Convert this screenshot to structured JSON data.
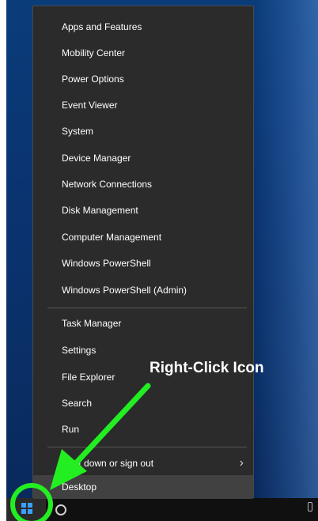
{
  "menu": {
    "groups": [
      {
        "items": [
          {
            "label": "Apps and Features"
          },
          {
            "label": "Mobility Center"
          },
          {
            "label": "Power Options"
          },
          {
            "label": "Event Viewer"
          },
          {
            "label": "System"
          },
          {
            "label": "Device Manager"
          },
          {
            "label": "Network Connections"
          },
          {
            "label": "Disk Management"
          },
          {
            "label": "Computer Management"
          },
          {
            "label": "Windows PowerShell"
          },
          {
            "label": "Windows PowerShell (Admin)"
          }
        ]
      },
      {
        "items": [
          {
            "label": "Task Manager"
          },
          {
            "label": "Settings"
          },
          {
            "label": "File Explorer"
          },
          {
            "label": "Search"
          },
          {
            "label": "Run"
          }
        ]
      },
      {
        "items": [
          {
            "label": "Shut down or sign out",
            "submenu": true
          },
          {
            "label": "Desktop",
            "active": true
          }
        ]
      }
    ]
  },
  "annotation": {
    "text": "Right-Click Icon",
    "color": "#22ee22"
  },
  "colors": {
    "menu_bg": "#2b2b2b",
    "accent": "#3aa0ff",
    "highlight": "#22ee22"
  }
}
